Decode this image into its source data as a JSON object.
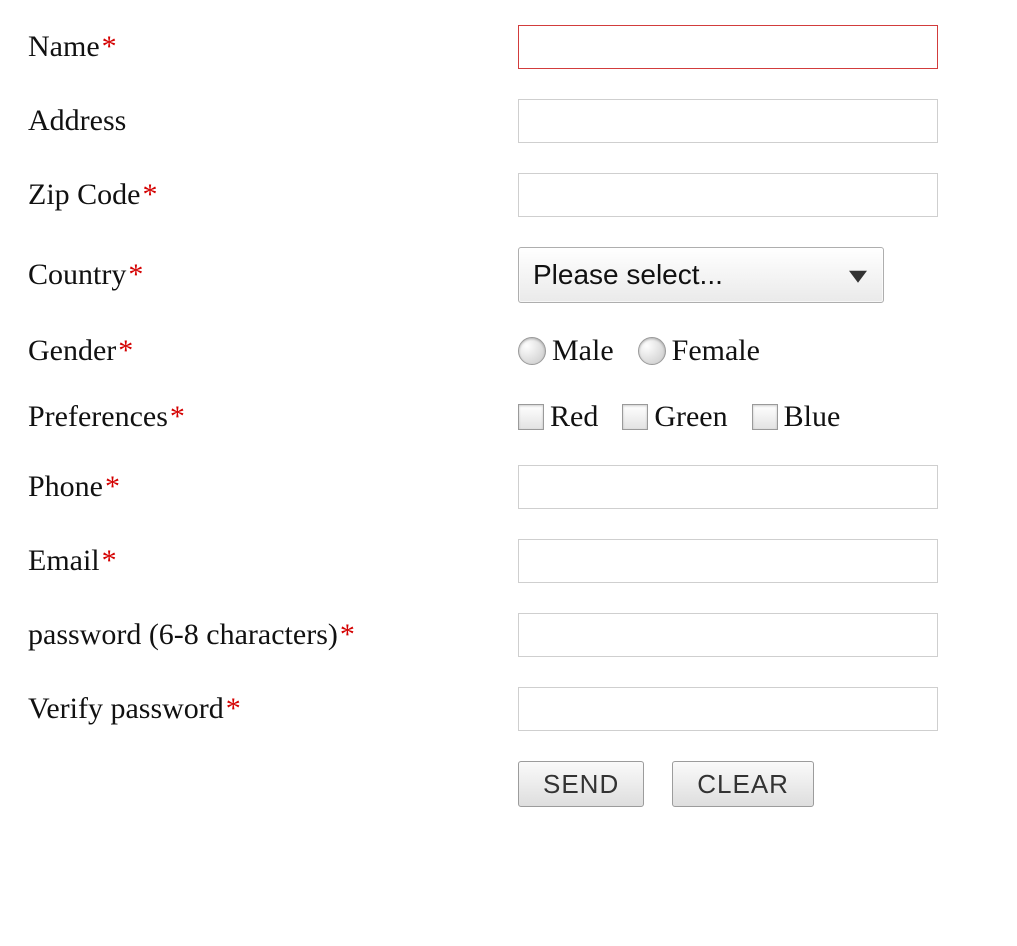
{
  "labels": {
    "name": "Name",
    "address": "Address",
    "zip": "Zip Code",
    "country": "Country",
    "gender": "Gender",
    "preferences": "Preferences",
    "phone": "Phone",
    "email": "Email",
    "password": "password (6-8 characters)",
    "verify": "Verify password"
  },
  "required_mark": "*",
  "country_select": {
    "selected": "Please select..."
  },
  "gender_options": {
    "male": "Male",
    "female": "Female"
  },
  "preference_options": {
    "red": "Red",
    "green": "Green",
    "blue": "Blue"
  },
  "buttons": {
    "send": "SEND",
    "clear": "CLEAR"
  },
  "values": {
    "name": "",
    "address": "",
    "zip": "",
    "phone": "",
    "email": "",
    "password": "",
    "verify": ""
  }
}
